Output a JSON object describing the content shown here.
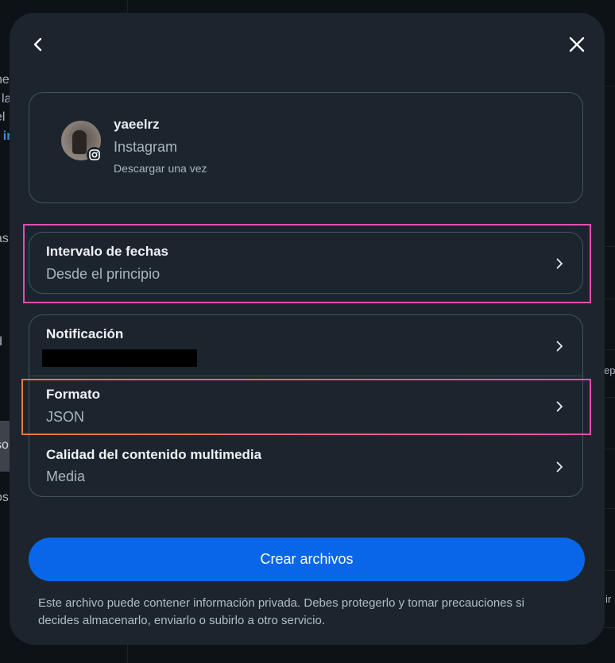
{
  "background": {
    "fragments": [
      "ne",
      "l la",
      "el",
      "t in",
      "as",
      "d",
      "so",
      "os",
      "ep",
      "ir"
    ]
  },
  "header": {
    "back_icon": "chevron-left-icon",
    "close_icon": "close-icon"
  },
  "account": {
    "username": "yaeelrz",
    "platform": "Instagram",
    "mode": "Descargar una vez",
    "badge_icon": "instagram-icon"
  },
  "options": {
    "date_range": {
      "title": "Intervalo de fechas",
      "value": "Desde el principio"
    },
    "notification": {
      "title": "Notificación",
      "value_redacted": true
    },
    "format": {
      "title": "Formato",
      "value": "JSON"
    },
    "media_quality": {
      "title": "Calidad del contenido multimedia",
      "value": "Media"
    },
    "chevron_icon": "chevron-right-icon"
  },
  "actions": {
    "create_label": "Crear archivos"
  },
  "disclaimer": "Este archivo puede contener información privada. Debes protegerlo y tomar precauciones si decides almacenarlo, enviarlo o subirlo a otro servicio.",
  "colors": {
    "modal_bg": "#1c252d",
    "primary_button": "#0a66e8",
    "highlight_pink": "#e24fb3",
    "highlight_orange": "#f07a3c"
  }
}
